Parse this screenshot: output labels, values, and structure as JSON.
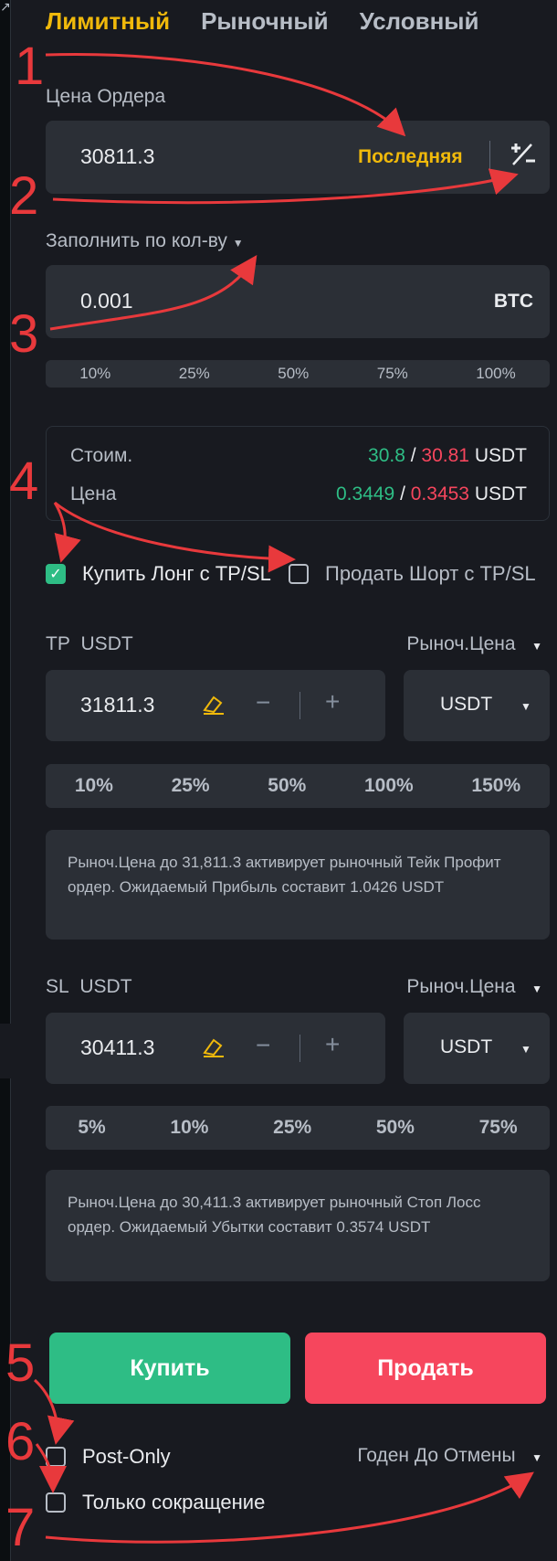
{
  "tabs": [
    "Лимитный",
    "Рыночный",
    "Условный"
  ],
  "order_price": {
    "label": "Цена Ордера",
    "value": "30811.3",
    "last_label": "Последняя",
    "adjust_icon": "plus-minus-icon"
  },
  "fill_mode": {
    "label": "Заполнить по кол-ву"
  },
  "quantity": {
    "value": "0.001",
    "unit": "BTC"
  },
  "qty_percentages": [
    "10%",
    "25%",
    "50%",
    "75%",
    "100%"
  ],
  "summary": {
    "cost_label": "Стоим.",
    "cost_buy": "30.8",
    "cost_sell": "30.81",
    "cost_unit": "USDT",
    "price_label": "Цена",
    "price_buy": "0.3449",
    "price_sell": "0.3453",
    "price_unit": "USDT",
    "separator": "/"
  },
  "tpsl_options": {
    "long_label": "Купить Лонг с TP/SL",
    "long_checked": true,
    "short_label": "Продать Шорт с TP/SL",
    "short_checked": false
  },
  "tp": {
    "label": "TP",
    "unit_label": "USDT",
    "trigger": "Рыноч.Цена",
    "value": "31811.3",
    "unit_select": "USDT",
    "percentages": [
      "10%",
      "25%",
      "50%",
      "100%",
      "150%"
    ],
    "info": "Рыноч.Цена до 31,811.3 активирует рыночный Тейк Профит ордер. Ожидаемый Прибыль составит 1.0426 USDT"
  },
  "sl": {
    "label": "SL",
    "unit_label": "USDT",
    "trigger": "Рыноч.Цена",
    "value": "30411.3",
    "unit_select": "USDT",
    "percentages": [
      "5%",
      "10%",
      "25%",
      "50%",
      "75%"
    ],
    "info": "Рыноч.Цена до 30,411.3 активирует рыночный Стоп Лосс ордер. Ожидаемый Убытки составит 0.3574 USDT"
  },
  "actions": {
    "buy": "Купить",
    "sell": "Продать"
  },
  "options": {
    "post_only": "Post-Only",
    "reduce_only": "Только сокращение",
    "tif": "Годен До Отмены"
  },
  "stepper": {
    "minus": "−",
    "plus": "+"
  },
  "annotations": [
    "1",
    "2",
    "3",
    "4",
    "5",
    "6",
    "7"
  ],
  "colors": {
    "accent": "#f0b90b",
    "buy": "#2ebd85",
    "sell": "#f6465d",
    "annotation": "#e8393c"
  }
}
